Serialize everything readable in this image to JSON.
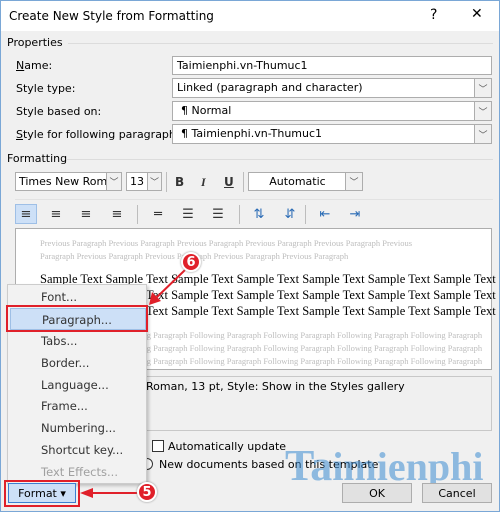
{
  "title": "Create New Style from Formatting",
  "help": "?",
  "close": "✕",
  "properties": {
    "heading": "Properties",
    "name": {
      "label": "Name:",
      "value": "Taimienphi.vn-Thumuc1"
    },
    "style_type": {
      "label": "Style type:",
      "value": "Linked (paragraph and character)"
    },
    "based_on": {
      "label": "Style based on:",
      "value": "¶  Normal"
    },
    "following": {
      "label": "Style for following paragraph:",
      "value": "¶  Taimienphi.vn-Thumuc1"
    }
  },
  "formatting": {
    "heading": "Formatting",
    "font": "Times New Roman",
    "size": "13",
    "bold": "B",
    "italic": "I",
    "underline": "U",
    "color": "Automatic"
  },
  "preview": {
    "previous": [
      "Previous Paragraph Previous Paragraph Previous Paragraph Previous Paragraph Previous Paragraph Previous",
      "Paragraph Previous Paragraph Previous Paragraph Previous Paragraph Previous Paragraph"
    ],
    "sample": [
      "Sample Text Sample Text Sample Text Sample Text Sample Text Sample Text Sample Text",
      "Sample Text Sample Text Sample Text Sample Text Sample Text Sample Text Sample Text",
      "Sample Text Sample Text Sample Text Sample Text Sample Text Sample Text Sample Text"
    ],
    "following": [
      "Following Paragraph Following Paragraph Following Paragraph Following Paragraph Following Paragraph",
      "Following Paragraph Following Paragraph Following Paragraph Following Paragraph Following Paragraph",
      "Following Paragraph Following Paragraph Following Paragraph Following Paragraph Following Paragraph"
    ]
  },
  "description": "Roman, 13 pt, Style: Show in the Styles gallery",
  "auto_update": {
    "label": "Automatically update",
    "checked": false
  },
  "new_docs": {
    "label": "New documents based on this template",
    "selected": false
  },
  "menu": {
    "items": [
      {
        "label": "Font...",
        "disabled": false
      },
      {
        "label": "Paragraph...",
        "highlighted": true
      },
      {
        "label": "Tabs..."
      },
      {
        "label": "Border..."
      },
      {
        "label": "Language..."
      },
      {
        "label": "Frame..."
      },
      {
        "label": "Numbering..."
      },
      {
        "label": "Shortcut key..."
      },
      {
        "label": "Text Effects...",
        "disabled": true
      }
    ]
  },
  "buttons": {
    "format": "Format ▾",
    "ok": "OK",
    "cancel": "Cancel"
  },
  "annotations": {
    "step5": "5",
    "step6": "6",
    "color": "#e0202a"
  },
  "watermark": "Taimienphi"
}
